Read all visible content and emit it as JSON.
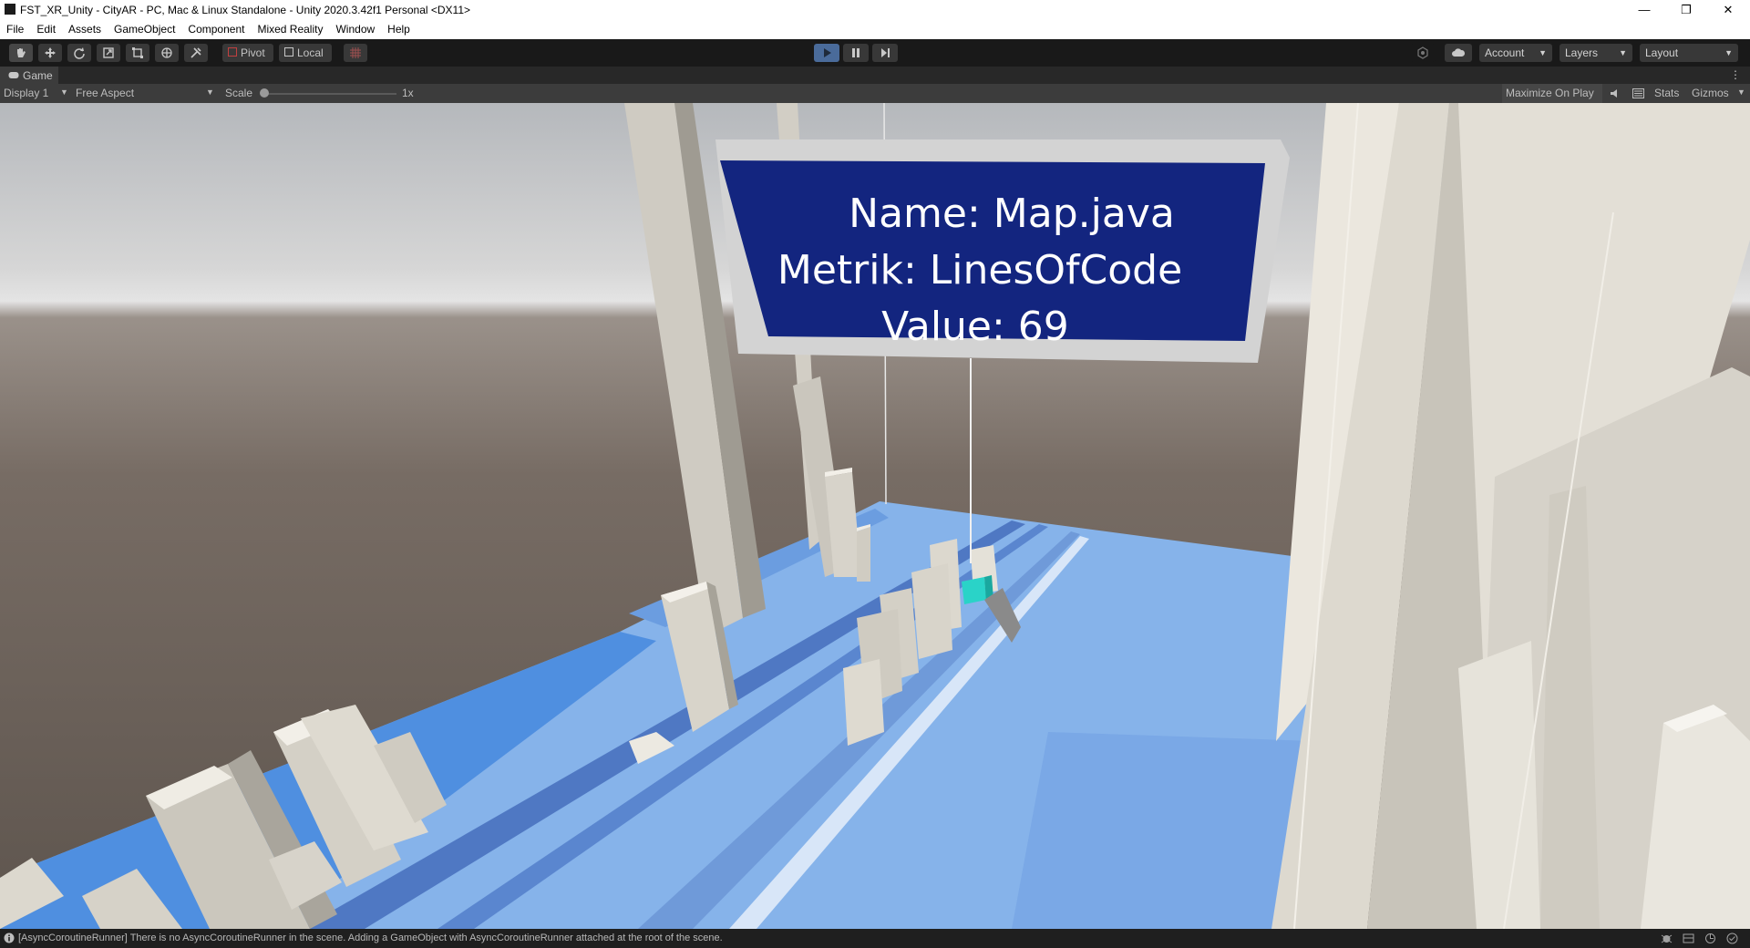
{
  "window": {
    "title": "FST_XR_Unity - CityAR - PC, Mac & Linux Standalone - Unity 2020.3.42f1 Personal <DX11>",
    "controls": {
      "minimize": "—",
      "restore": "❐",
      "close": "✕"
    }
  },
  "menu": [
    "File",
    "Edit",
    "Assets",
    "GameObject",
    "Component",
    "Mixed Reality",
    "Window",
    "Help"
  ],
  "toolbar": {
    "tools": [
      "hand-tool-icon",
      "move-tool-icon",
      "rotate-tool-icon",
      "scale-tool-icon",
      "rect-tool-icon",
      "transform-tool-icon",
      "custom-tool-icon"
    ],
    "pivot_label": "Pivot",
    "local_label": "Local",
    "account_label": "Account",
    "layers_label": "Layers",
    "layout_label": "Layout"
  },
  "game_tab": {
    "label": "Game"
  },
  "game_bar": {
    "display": "Display 1",
    "aspect": "Free Aspect",
    "scale_label": "Scale",
    "scale_value": "1x",
    "maximize_label": "Maximize On Play",
    "stats_label": "Stats",
    "gizmos_label": "Gizmos"
  },
  "info_panel": {
    "name_line": "Name: Map.java",
    "metric_line": "Metrik: LinesOfCode",
    "value_line": "Value: 69"
  },
  "status": {
    "message": "[AsyncCoroutineRunner] There is no AsyncCoroutineRunner in the scene. Adding a GameObject with AsyncCoroutineRunner attached at the root of the scene."
  },
  "colors": {
    "panel_blue": "#13257f",
    "highlight_cyan": "#2ad3c8",
    "floor_blue": "#86b3ea",
    "toolbar_bg": "#191919"
  }
}
